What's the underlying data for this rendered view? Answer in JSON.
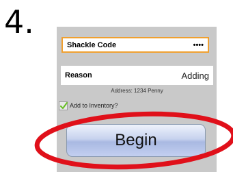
{
  "step": {
    "number": "4."
  },
  "shackle_code": {
    "label": "Shackle Code",
    "value": "••••"
  },
  "reason": {
    "label": "Reason",
    "value": "Adding"
  },
  "address": {
    "text": "Address: 1234 Penny"
  },
  "inventory": {
    "label": "Add to Inventory?",
    "checked": true
  },
  "begin_button": {
    "label": "Begin"
  },
  "colors": {
    "highlight": "#e0101a",
    "field_border": "#f0a030",
    "checkmark": "#6bbf2a",
    "panel": "#c9c9c9"
  }
}
